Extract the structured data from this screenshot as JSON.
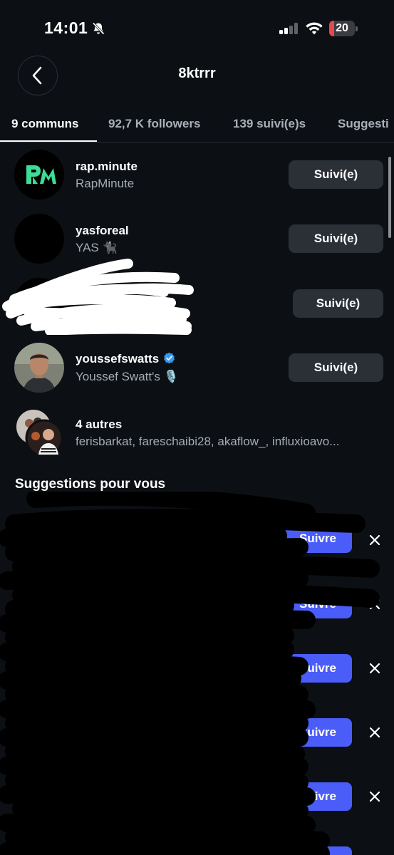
{
  "status_bar": {
    "time": "14:01",
    "battery_level": "20",
    "icons": [
      "bell-slash-icon",
      "cellular-signal-icon",
      "wifi-icon",
      "battery-icon"
    ]
  },
  "header": {
    "title": "8ktrrr",
    "back_icon": "chevron-left-icon"
  },
  "tabs": [
    {
      "label": "9 communs",
      "active": true
    },
    {
      "label": "92,7 K followers",
      "active": false
    },
    {
      "label": "139 suivi(e)s",
      "active": false
    },
    {
      "label": "Suggesti",
      "active": false
    }
  ],
  "mutuals": [
    {
      "username": "rap.minute",
      "display_name": "RapMinute",
      "button": "Suivi(e)"
    },
    {
      "username": "yasforeal",
      "display_name": "YAS 🐈‍⬛",
      "button": "Suivi(e)"
    },
    {
      "username": "",
      "display_name": "",
      "button": "Suivi(e)"
    },
    {
      "username": "youssefswatts",
      "display_name": "Youssef Swatt's 🎙️",
      "button": "Suivi(e)",
      "verified": true
    }
  ],
  "others": {
    "title": "4 autres",
    "names": "ferisbarkat, fareschaibi28, akaflow_, influxioavo..."
  },
  "suggestions": {
    "title": "Suggestions pour vous",
    "items": [
      {
        "button": "Suivre",
        "dismiss_icon": "close-icon"
      },
      {
        "button": "Suivre",
        "dismiss_icon": "close-icon"
      },
      {
        "button": "Suivre",
        "dismiss_icon": "close-icon"
      },
      {
        "button": "Suivre",
        "dismiss_icon": "close-icon"
      },
      {
        "button": "Suivre",
        "dismiss_icon": "close-icon"
      },
      {
        "button": "Suivre",
        "dismiss_icon": "close-icon"
      }
    ]
  },
  "colors": {
    "background": "#0c0f14",
    "follow_button": "#4a5df9",
    "following_button": "#2b2f36",
    "verified_badge": "#3897f0"
  }
}
